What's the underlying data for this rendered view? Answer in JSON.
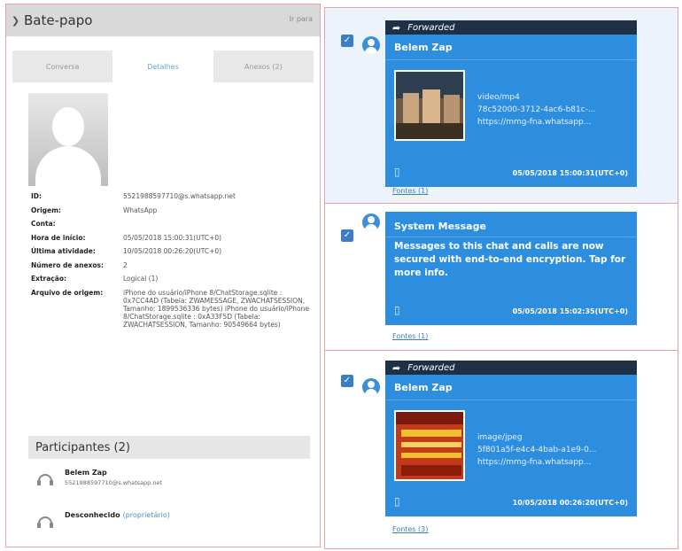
{
  "left": {
    "title": "Bate-papo",
    "position": "Ir para",
    "tabs": [
      "Conversa",
      "Detalhes",
      "Anexos (2)"
    ],
    "details": [
      {
        "k": "ID:",
        "v": "5521988597710@s.whatsapp.net"
      },
      {
        "k": "Origem:",
        "v": "WhatsApp"
      },
      {
        "k": "Conta:",
        "v": ""
      },
      {
        "k": "Hora de início:",
        "v": "05/05/2018 15:00:31(UTC+0)"
      },
      {
        "k": "Última atividade:",
        "v": "10/05/2018 00:26:20(UTC+0)"
      },
      {
        "k": "Número de anexos:",
        "v": "2"
      },
      {
        "k": "Extração:",
        "v": "Logical (1)"
      },
      {
        "k": "Arquivo de origem:",
        "v": "iPhone do usuário/iPhone 8/ChatStorage.sqlite : 0x7CC4AD (Tabela: ZWAMESSAGE, ZWACHATSESSION, Tamanho: 1899536336 bytes) iPhone do usuário/iPhone 8/ChatStorage.sqlite : 0xA33F5D (Tabela: ZWACHATSESSION, Tamanho: 90549664 bytes)"
      }
    ],
    "participants_title": "Participantes (2)",
    "participants": [
      {
        "name": "Belem Zap",
        "id": "5521988597710@s.whatsapp.net"
      },
      {
        "name": "Desconhecido",
        "link": "(proprietário)"
      }
    ]
  },
  "right": {
    "messages": [
      {
        "forwarded": "Forwarded",
        "sender": "Belem Zap",
        "attachment": [
          "video/mp4",
          "78c52000-3712-4ac6-b81c-...",
          "https://mmg-fna.whatsapp..."
        ],
        "timestamp": "05/05/2018 15:00:31(UTC+0)",
        "source": "Fontes (1)"
      },
      {
        "sender": "System Message",
        "text": "Messages to this chat and calls are now secured with end-to-end encryption. Tap for more info.",
        "timestamp": "05/05/2018 15:02:35(UTC+0)",
        "source": "Fontes (1)"
      },
      {
        "forwarded": "Forwarded",
        "sender": "Belem Zap",
        "attachment": [
          "image/jpeg",
          "5f801a5f-e4c4-4bab-a1e9-0...",
          "https://mmg-fna.whatsapp..."
        ],
        "timestamp": "10/05/2018 00:26:20(UTC+0)",
        "source": "Fontes (3)"
      }
    ]
  },
  "colors": {
    "bubble": "#2d8ee0",
    "forward_bar": "#1e3046",
    "selected_row": "#ecf3fb",
    "panel_border": "#e9a3a7",
    "link": "#3a7fc4"
  }
}
